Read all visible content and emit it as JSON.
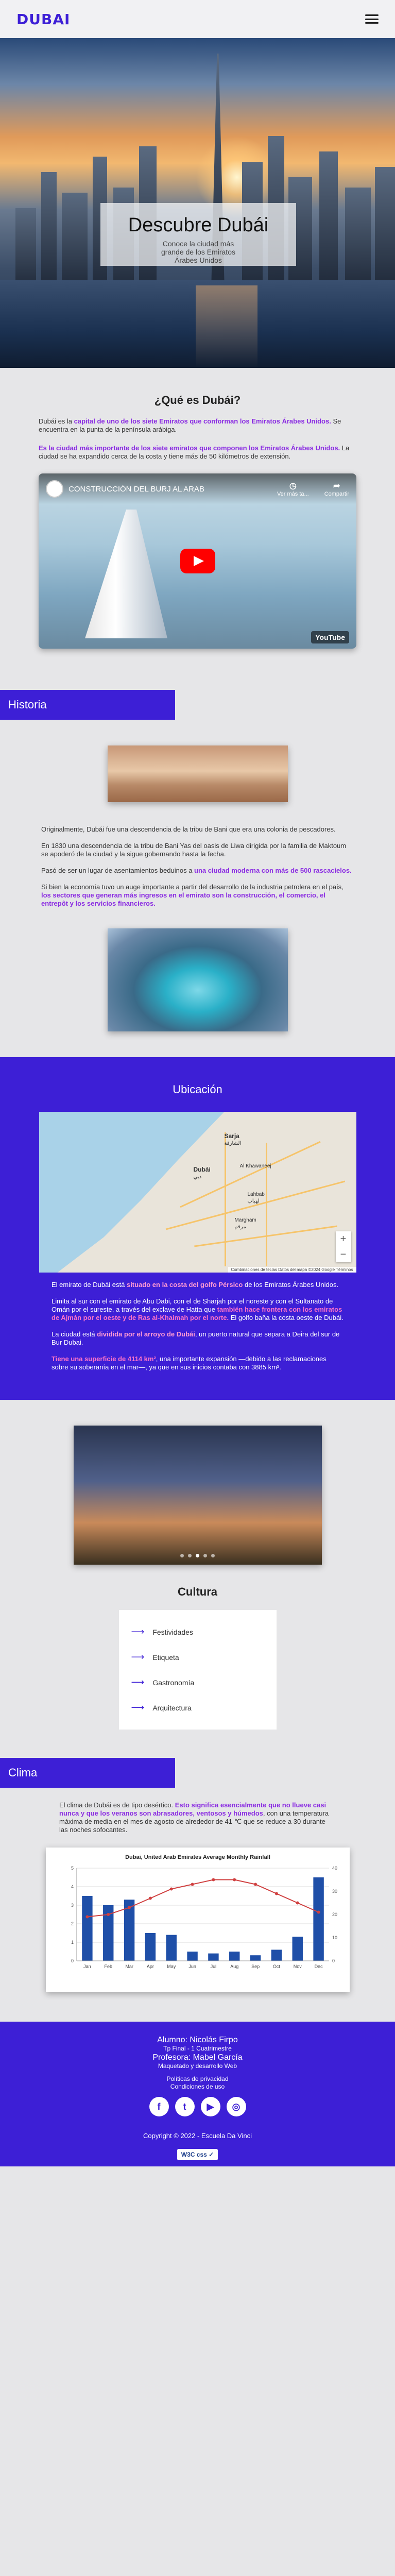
{
  "header": {
    "logo": "DUBAI"
  },
  "hero": {
    "title": "Descubre Dubái",
    "subtitle": "Conoce la ciudad más grande de los Emiratos Árabes Unidos"
  },
  "que": {
    "title": "¿Qué es Dubái?",
    "p1_a": "Dubái es la ",
    "p1_b": "capital de uno de los siete Emiratos que conforman los Emiratos Árabes Unidos.",
    "p1_c": " Se encuentra en la punta de la península arábiga.",
    "p2_a": "Es la ciudad más importante de los siete emiratos que componen los Emiratos Árabes Unidos.",
    "p2_b": " La ciudad se ha expandido cerca de la costa y tiene más de 50 kilómetros de extensión.",
    "video": {
      "title": "CONSTRUCCIÓN DEL BURJ AL ARAB",
      "later": "Ver más ta...",
      "share": "Compartir",
      "brand": "YouTube"
    }
  },
  "historia": {
    "band": "Historia",
    "p1": "Originalmente, Dubái fue una descendencia de la tribu de Bani que era una colonia de pescadores.",
    "p2": "En 1830 una descendencia de la tribu de Bani Yas del oasis de Liwa dirigida por la familia de Maktoum se apoderó de la ciudad y la sigue gobernando hasta la fecha.",
    "p3_a": "Pasó de ser un lugar de asentamientos beduinos a ",
    "p3_b": "una ciudad moderna con más de 500 rascacielos.",
    "p4_a": "Si bien la economía tuvo un auge importante a partir del desarrollo de la industria petrolera en el país, ",
    "p4_b": "los sectores que generan más ingresos en el emirato son la construcción, el comercio, el entrepôt y los servicios financieros."
  },
  "ubicacion": {
    "title": "Ubicación",
    "map": {
      "sarja": "Sarja",
      "sarja_ar": "الشارقة",
      "dubai": "Dubái",
      "dubai_ar": "دبي",
      "labels": [
        "Al Khawaneej",
        "Lahbab",
        "لهباب",
        "Margham",
        "مرقم"
      ],
      "credit": "Combinaciones de teclas   Datos del mapa ©2024 Google   Términos"
    },
    "p1_a": "El emirato de Dubái está ",
    "p1_b": "situado en la costa del golfo Pérsico",
    "p1_c": " de los Emiratos Árabes Unidos.",
    "p2_a": "Limita al sur con el emirato de Abu Dabi, con el de Sharjah por el noreste y con el Sultanato de Omán por el sureste, a través del exclave de Hatta que ",
    "p2_b": "también hace frontera con los emiratos de Ajmán por el oeste y de Ras al-Khaimah por el norte.",
    "p2_c": " El golfo baña la costa oeste de Dubái.",
    "p3_a": "La ciudad está ",
    "p3_b": "dividida por el arroyo de Dubái",
    "p3_c": ", un puerto natural que separa a Deira del sur de Bur Dubai.",
    "p4_a": "Tiene una superficie de 4114 km²",
    "p4_b": ", una importante expansión —debido a las reclamaciones sobre su soberanía en el mar—, ya que en sus inicios contaba con 3885 km²."
  },
  "cultura": {
    "title": "Cultura",
    "items": [
      "Festividades",
      "Etiqueta",
      "Gastronomía",
      "Arquitectura"
    ],
    "arrow": "⟶"
  },
  "clima": {
    "band": "Clima",
    "p1_a": "El clima de Dubái es de tipo desértico. ",
    "p1_b": "Esto significa esencialmente que no llueve casi nunca y que los veranos son abrasadores, ventosos y húmedos",
    "p1_c": ", con una temperatura máxima de media en el mes de agosto de alrededor de 41 ℃ que se reduce a 30 durante las noches sofocantes."
  },
  "chart_data": {
    "type": "bar",
    "title": "Dubai, United Arab Emirates Average Monthly Rainfall",
    "subtitle": "",
    "categories": [
      "Jan",
      "Feb",
      "Mar",
      "Apr",
      "May",
      "Jun",
      "Jul",
      "Aug",
      "Sep",
      "Oct",
      "Nov",
      "Dec"
    ],
    "series": [
      {
        "name": "",
        "kind": "bar",
        "values": [
          3.5,
          3.0,
          3.3,
          1.5,
          1.4,
          0.5,
          0.4,
          0.5,
          0.3,
          0.6,
          1.3,
          4.5
        ]
      },
      {
        "name": "",
        "kind": "line",
        "values": [
          19,
          20,
          23,
          27,
          31,
          33,
          35,
          35,
          33,
          29,
          25,
          21
        ]
      }
    ],
    "ylim": [
      0,
      5
    ],
    "y2lim": [
      0,
      40
    ],
    "grid": true,
    "colors": {
      "bars": "#1f4fa8",
      "line": "#d04040"
    }
  },
  "footer": {
    "alumno": "Alumno: Nicolás Firpo",
    "tp": "Tp Final - 1 Cuatrimestre",
    "profesora": "Profesora: Mabel García",
    "maquetado": "Maquetado y desarrollo Web",
    "privacidad": "Políticas de privacidad",
    "condiciones": "Condiciones de uso",
    "social": [
      "f",
      "t",
      "▶",
      "◎"
    ],
    "copyright": "Copyright © 2022 - Escuela Da Vinci",
    "w3c": "W3C css ✓"
  },
  "colors": {
    "primary": "#3d1fd6",
    "highlight": "#8a2be2"
  }
}
